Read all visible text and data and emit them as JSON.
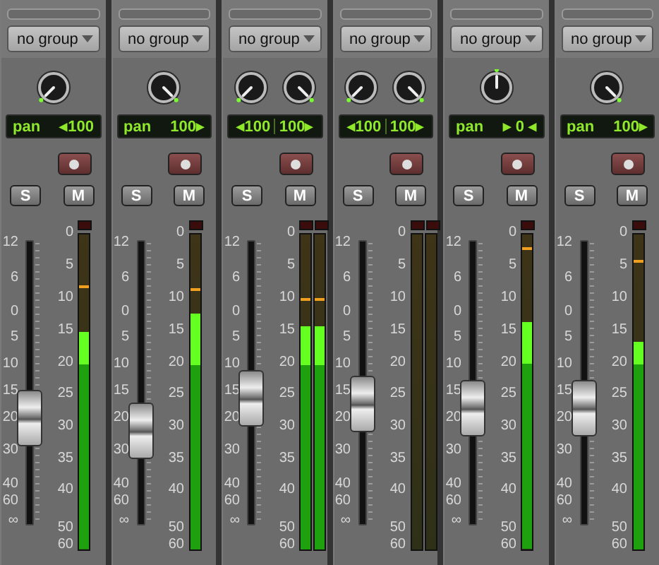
{
  "strips": [
    {
      "kind": "mono",
      "group": "no group",
      "knobs": [
        {
          "level": 0
        }
      ],
      "display": [
        "pan",
        "◂100"
      ],
      "solo": "S",
      "mute": "M",
      "fader": {
        "level": 0.375
      },
      "meters": [
        {
          "clip": false,
          "level": 0.69,
          "peak_hold": {
            "level": 0.83
          }
        }
      ],
      "fader_scale": [
        "12",
        "6",
        "0",
        "5",
        "10",
        "15",
        "20",
        "30",
        "40",
        "60",
        "∞"
      ],
      "meter_scale": [
        "0",
        "5",
        "10",
        "15",
        "20",
        "25",
        "30",
        "35",
        "40",
        "50",
        "60"
      ]
    },
    {
      "kind": "mono",
      "group": "no group",
      "knobs": [
        {
          "level": 1
        }
      ],
      "display": [
        "pan",
        "100▸"
      ],
      "solo": "S",
      "mute": "M",
      "fader": {
        "level": 0.33
      },
      "meters": [
        {
          "clip": false,
          "level": 0.75,
          "peak_hold": {
            "level": 0.82
          }
        }
      ],
      "fader_scale": [
        "12",
        "6",
        "0",
        "5",
        "10",
        "15",
        "20",
        "30",
        "40",
        "60",
        "∞"
      ],
      "meter_scale": [
        "0",
        "5",
        "10",
        "15",
        "20",
        "25",
        "30",
        "35",
        "40",
        "50",
        "60"
      ]
    },
    {
      "kind": "stereo",
      "group": "no group",
      "knobs": [
        {
          "level": 0
        },
        {
          "level": 1
        }
      ],
      "display": [
        "◂100",
        "100▸"
      ],
      "solo": "S",
      "mute": "M",
      "fader": {
        "level": 0.445
      },
      "meters": [
        {
          "clip": false,
          "level": 0.71,
          "peak_hold": {
            "level": 0.79
          }
        },
        {
          "clip": false,
          "level": 0.71,
          "peak_hold": {
            "level": 0.79
          }
        }
      ],
      "fader_scale": [
        "12",
        "6",
        "0",
        "5",
        "10",
        "15",
        "20",
        "30",
        "40",
        "60",
        "∞"
      ],
      "meter_scale": [
        "0",
        "5",
        "10",
        "15",
        "20",
        "25",
        "30",
        "35",
        "40",
        "50",
        "60"
      ]
    },
    {
      "kind": "stereo",
      "group": "no group",
      "knobs": [
        {
          "level": 0
        },
        {
          "level": 1
        }
      ],
      "display": [
        "◂100",
        "100▸"
      ],
      "solo": "S",
      "mute": "M",
      "fader": {
        "level": 0.425
      },
      "meters": [
        {
          "clip": false
        },
        {
          "clip": false
        }
      ],
      "fader_scale": [
        "12",
        "6",
        "0",
        "5",
        "10",
        "15",
        "20",
        "30",
        "40",
        "60",
        "∞"
      ],
      "meter_scale": [
        "0",
        "5",
        "10",
        "15",
        "20",
        "25",
        "30",
        "35",
        "40",
        "50",
        "60"
      ]
    },
    {
      "kind": "mono",
      "group": "no group",
      "knobs": [
        {
          "level": 0.5
        }
      ],
      "display": [
        "pan",
        "▸ 0 ◂"
      ],
      "solo": "S",
      "mute": "M",
      "fader": {
        "level": 0.41
      },
      "meters": [
        {
          "clip": false,
          "level": 0.72,
          "peak_hold": {
            "level": 0.95
          }
        }
      ],
      "fader_scale": [
        "12",
        "6",
        "0",
        "5",
        "10",
        "15",
        "20",
        "30",
        "40",
        "60",
        "∞"
      ],
      "meter_scale": [
        "0",
        "5",
        "10",
        "15",
        "20",
        "25",
        "30",
        "35",
        "40",
        "50",
        "60"
      ]
    },
    {
      "kind": "mono",
      "group": "no group",
      "knobs": [
        {
          "level": 1
        }
      ],
      "display": [
        "pan",
        "100▸"
      ],
      "solo": "S",
      "mute": "M",
      "fader": {
        "level": 0.41
      },
      "meters": [
        {
          "clip": false,
          "level": 0.66,
          "peak_hold": {
            "level": 0.91
          }
        }
      ],
      "fader_scale": [
        "12",
        "6",
        "0",
        "5",
        "10",
        "15",
        "20",
        "30",
        "40",
        "60",
        "∞"
      ],
      "meter_scale": [
        "0",
        "5",
        "10",
        "15",
        "20",
        "25",
        "30",
        "35",
        "40",
        "50",
        "60"
      ]
    }
  ]
}
